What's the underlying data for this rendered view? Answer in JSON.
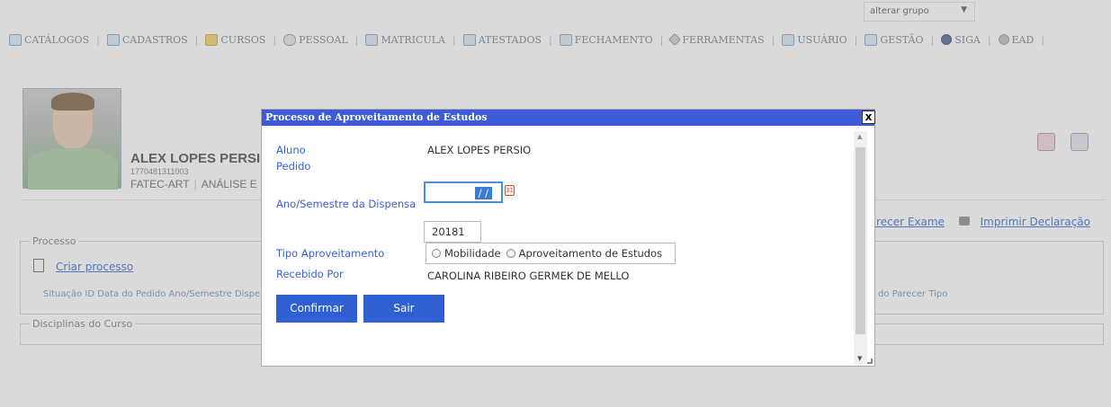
{
  "header": {
    "group_select": "alterar grupo",
    "nav": [
      "CATÁLOGOS",
      "CADASTROS",
      "CURSOS",
      "PESSOAL",
      "MATRICULA",
      "ATESTADOS",
      "FECHAMENTO",
      "FERRAMENTAS",
      "USUÁRIO",
      "GESTÃO",
      "SIGA",
      "EAD"
    ]
  },
  "student": {
    "name": "ALEX LOPES PERSIO",
    "ra": "1770481311003",
    "unit": "FATEC-ART",
    "course": "ANÁLISE E"
  },
  "links": {
    "parecer": "Parecer Exame",
    "imprimir": "Imprimir Declaração"
  },
  "processo": {
    "legend": "Processo",
    "create": "Criar processo",
    "headers": "Situação ID Data do Pedido Ano/Semestre Dispe",
    "headers_right": "do Parecer Tipo"
  },
  "disciplinas": {
    "legend": "Disciplinas do Curso"
  },
  "modal": {
    "title": "Processo de Aproveitamento de Estudos",
    "close": "x",
    "labels": {
      "aluno": "Aluno",
      "pedido": "Pedido",
      "ano_semestre": "Ano/Semestre da Dispensa",
      "tipo": "Tipo Aproveitamento",
      "recebido": "Recebido Por"
    },
    "values": {
      "aluno": "ALEX LOPES PERSIO",
      "pedido": "/ /",
      "ano_semestre": "20181",
      "recebido": "CAROLINA RIBEIRO GERMEK DE MELLO"
    },
    "radio_options": [
      "Mobilidade",
      "Aproveitamento de Estudos"
    ],
    "buttons": {
      "confirm": "Confirmar",
      "exit": "Sair"
    }
  }
}
